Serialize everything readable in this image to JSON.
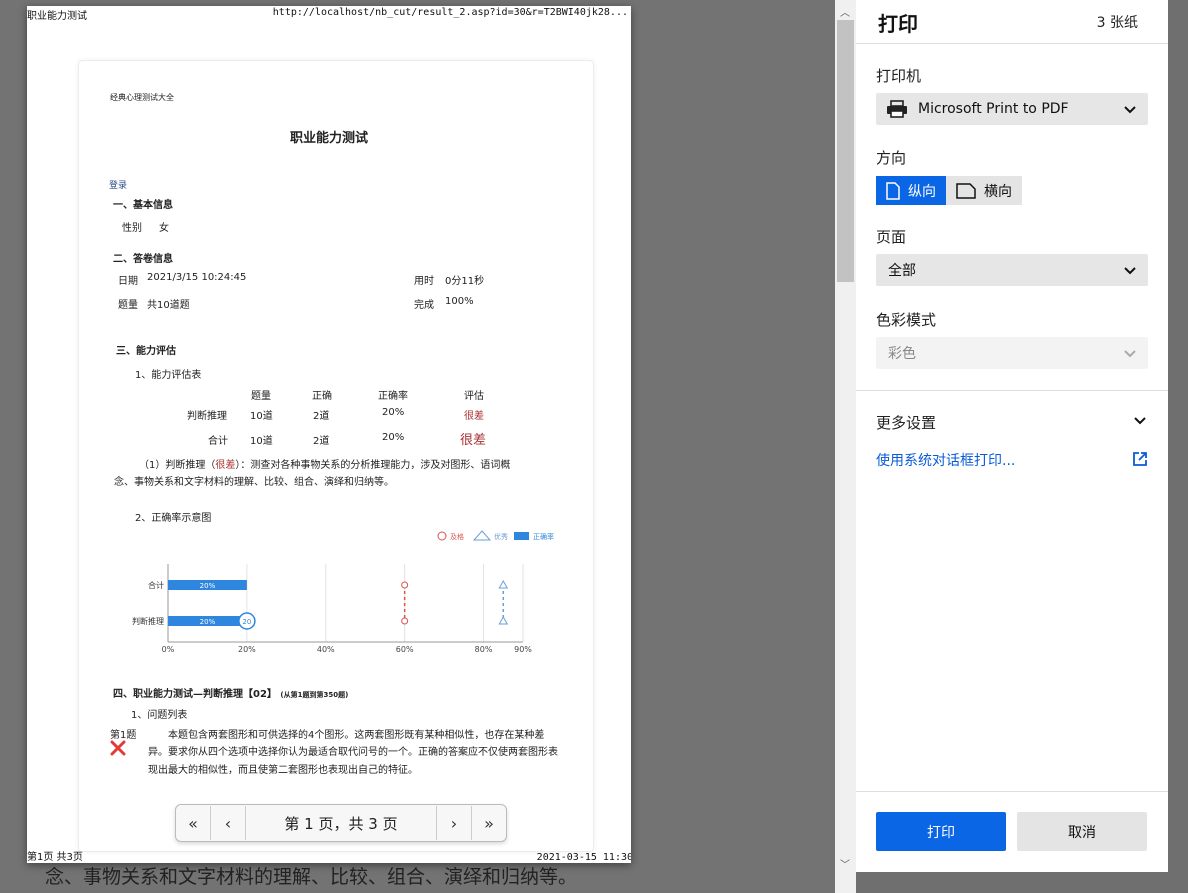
{
  "background_text": "念、事物关系和文字材料的理解、比较、组合、演绎和归纳等。",
  "preview": {
    "header_title": "职业能力测试",
    "header_url": "http://localhost/nb_cut/result_2.asp?id=30&r=T2BWI40jk28...",
    "footer_page": "第1页 共3页",
    "footer_date": "2021-03-15 11:30",
    "site_name": "经典心理测试大全",
    "doc_title": "职业能力测试",
    "login": "登录",
    "sec1": "一、基本信息",
    "gender_label": "性别",
    "gender_value": "女",
    "sec2": "二、答卷信息",
    "date_label": "日期",
    "date_value": "2021/3/15 10:24:45",
    "time_label": "用时",
    "time_value": "0分11秒",
    "count_label": "题量",
    "count_value": "共10道题",
    "done_label": "完成",
    "done_value": "100%",
    "sec3": "三、能力评估",
    "sub1": "1、能力评估表",
    "table_headers": [
      "题量",
      "正确",
      "正确率",
      "评估"
    ],
    "table_rows": [
      {
        "name": "判断推理",
        "count": "10道",
        "correct": "2道",
        "rate": "20%",
        "eval": "很差"
      },
      {
        "name": "合计",
        "count": "10道",
        "correct": "2道",
        "rate": "20%",
        "eval": "很差"
      }
    ],
    "desc_a": "（1）判断推理（",
    "desc_b": "很差",
    "desc_c": "）：测查对各种事物关系的分析推理能力，涉及对图形、语词概",
    "desc_line2": "念、事物关系和文字材料的理解、比较、组合、演绎和归纳等。",
    "sub2": "2、正确率示意图",
    "sec4": "四、职业能力测试—判断推理【02】",
    "sec4_note": "(从第1题到第350题)",
    "sub4": "1、问题列表",
    "q_label": "第1题",
    "q_lines": [
      "本题包含两套图形和可供选择的4个图形。这两套图形既有某种相似性，也存在某种差",
      "异。要求你从四个选项中选择你认为最适合取代问号的一个。正确的答案应不仅使两套图形表",
      "现出最大的相似性，而且使第二套图形也表现出自己的特征。"
    ],
    "pager_text": "第 1 页，共 3 页"
  },
  "chart_data": {
    "type": "bar",
    "orientation": "horizontal",
    "categories": [
      "合计",
      "判断推理"
    ],
    "series": [
      {
        "name": "正确率",
        "values": [
          20,
          20
        ],
        "labels": [
          "20%",
          "20%"
        ]
      }
    ],
    "markers": [
      {
        "name": "及格",
        "value": 60,
        "shape": "circle",
        "color": "#d9534f"
      },
      {
        "name": "优秀",
        "value": 85,
        "shape": "triangle",
        "color": "#6a9fd4"
      }
    ],
    "end_label": "20",
    "x_ticks": [
      "0%",
      "20%",
      "40%",
      "60%",
      "80%",
      "90%"
    ],
    "x_tick_values": [
      0,
      20,
      40,
      60,
      80,
      90
    ],
    "xlim": [
      0,
      90
    ],
    "legend": [
      "及格",
      "优秀",
      "正确率"
    ],
    "legend_position": "top-right",
    "colors": {
      "bar": "#2e86de",
      "pass": "#d9534f",
      "excellent": "#6a9fd4"
    }
  },
  "panel": {
    "title": "打印",
    "sheets": "3 张纸",
    "printer_label": "打印机",
    "printer_value": "Microsoft Print to PDF",
    "orientation_label": "方向",
    "portrait": "纵向",
    "landscape": "横向",
    "pages_label": "页面",
    "pages_value": "全部",
    "color_label": "色彩模式",
    "color_value": "彩色",
    "more_settings": "更多设置",
    "system_dialog": "使用系统对话框打印...",
    "print_button": "打印",
    "cancel_button": "取消"
  }
}
